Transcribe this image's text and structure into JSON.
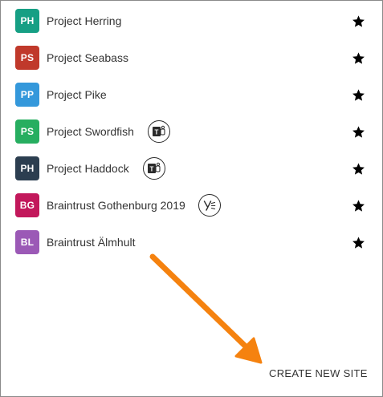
{
  "sites": [
    {
      "initials": "PH",
      "name": "Project Herring",
      "color": "#169f84",
      "badge": null
    },
    {
      "initials": "PS",
      "name": "Project Seabass",
      "color": "#c0392b",
      "badge": null
    },
    {
      "initials": "PP",
      "name": "Project Pike",
      "color": "#3498db",
      "badge": null
    },
    {
      "initials": "PS",
      "name": "Project Swordfish",
      "color": "#27ae60",
      "badge": "teams-icon"
    },
    {
      "initials": "PH",
      "name": "Project Haddock",
      "color": "#2c3e50",
      "badge": "teams-icon"
    },
    {
      "initials": "BG",
      "name": "Braintrust Gothenburg 2019",
      "color": "#c2185b",
      "badge": "yammer-icon"
    },
    {
      "initials": "BL",
      "name": "Braintrust Älmhult",
      "color": "#9b59b6",
      "badge": null
    }
  ],
  "favorite_icon": "star-icon",
  "create_button_label": "CREATE NEW SITE",
  "annotation_color": "#f5820f"
}
